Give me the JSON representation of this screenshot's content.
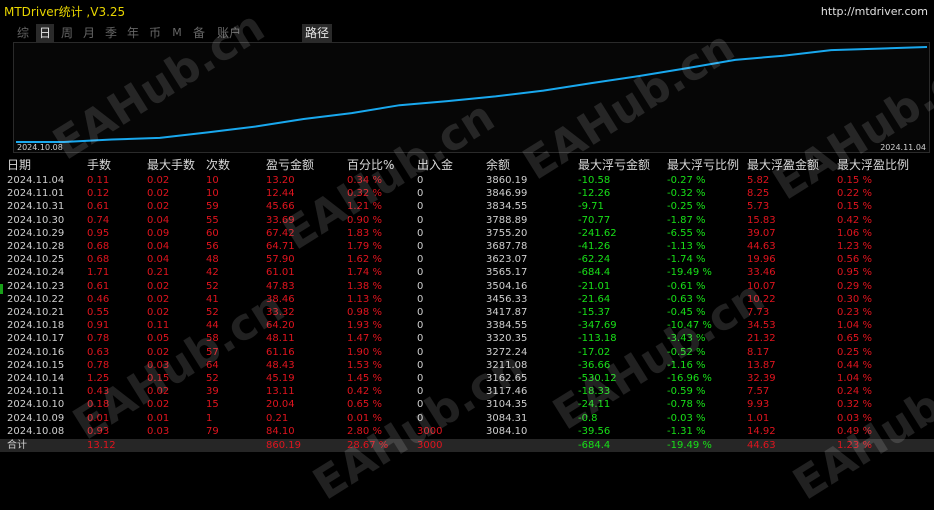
{
  "app": {
    "title": "MTDriver统计 ,V3.25",
    "url": "http://mtdriver.com"
  },
  "tabs": [
    {
      "label": "综",
      "active": false
    },
    {
      "label": "日",
      "active": true
    },
    {
      "label": "周",
      "active": false
    },
    {
      "label": "月",
      "active": false
    },
    {
      "label": "季",
      "active": false
    },
    {
      "label": "年",
      "active": false
    },
    {
      "label": "币",
      "active": false
    },
    {
      "label": "M",
      "active": false
    },
    {
      "label": "备",
      "active": false
    },
    {
      "label": "账户",
      "active": false
    },
    {
      "label": "路径",
      "active": true
    }
  ],
  "chart_data": {
    "type": "line",
    "x_start_label": "2024.10.08",
    "x_end_label": "2024.11.04",
    "x": [
      "2024.10.08",
      "2024.10.09",
      "2024.10.10",
      "2024.10.11",
      "2024.10.14",
      "2024.10.15",
      "2024.10.16",
      "2024.10.17",
      "2024.10.18",
      "2024.10.21",
      "2024.10.22",
      "2024.10.23",
      "2024.10.24",
      "2024.10.25",
      "2024.10.28",
      "2024.10.29",
      "2024.10.30",
      "2024.10.31",
      "2024.11.01",
      "2024.11.04"
    ],
    "y": [
      3084.1,
      3084.31,
      3104.35,
      3117.46,
      3162.65,
      3211.08,
      3272.24,
      3320.35,
      3384.55,
      3417.87,
      3456.33,
      3504.16,
      3565.17,
      3623.07,
      3687.78,
      3755.2,
      3788.89,
      3834.55,
      3846.99,
      3860.19
    ],
    "series_color": "#19a8ee",
    "grid": false
  },
  "table": {
    "headers": [
      "日期",
      "手数",
      "最大手数",
      "次数",
      "盈亏金额",
      "百分比%",
      "出入金",
      "余额",
      "最大浮亏金额",
      "最大浮亏比例",
      "最大浮盈金额",
      "最大浮盈比例"
    ],
    "rows": [
      [
        "2024.11.04",
        "0.11",
        "0.02",
        "10",
        "13.20",
        "0.34 %",
        "0",
        "3860.19",
        "-10.58",
        "-0.27 %",
        "5.82",
        "0.15 %"
      ],
      [
        "2024.11.01",
        "0.12",
        "0.02",
        "10",
        "12.44",
        "0.32 %",
        "0",
        "3846.99",
        "-12.26",
        "-0.32 %",
        "8.25",
        "0.22 %"
      ],
      [
        "2024.10.31",
        "0.61",
        "0.02",
        "59",
        "45.66",
        "1.21 %",
        "0",
        "3834.55",
        "-9.71",
        "-0.25 %",
        "5.73",
        "0.15 %"
      ],
      [
        "2024.10.30",
        "0.74",
        "0.04",
        "55",
        "33.69",
        "0.90 %",
        "0",
        "3788.89",
        "-70.77",
        "-1.87 %",
        "15.83",
        "0.42 %"
      ],
      [
        "2024.10.29",
        "0.95",
        "0.09",
        "60",
        "67.42",
        "1.83 %",
        "0",
        "3755.20",
        "-241.62",
        "-6.55 %",
        "39.07",
        "1.06 %"
      ],
      [
        "2024.10.28",
        "0.68",
        "0.04",
        "56",
        "64.71",
        "1.79 %",
        "0",
        "3687.78",
        "-41.26",
        "-1.13 %",
        "44.63",
        "1.23 %"
      ],
      [
        "2024.10.25",
        "0.68",
        "0.04",
        "48",
        "57.90",
        "1.62 %",
        "0",
        "3623.07",
        "-62.24",
        "-1.74 %",
        "19.96",
        "0.56 %"
      ],
      [
        "2024.10.24",
        "1.71",
        "0.21",
        "42",
        "61.01",
        "1.74 %",
        "0",
        "3565.17",
        "-684.4",
        "-19.49 %",
        "33.46",
        "0.95 %"
      ],
      [
        "2024.10.23",
        "0.61",
        "0.02",
        "52",
        "47.83",
        "1.38 %",
        "0",
        "3504.16",
        "-21.01",
        "-0.61 %",
        "10.07",
        "0.29 %"
      ],
      [
        "2024.10.22",
        "0.46",
        "0.02",
        "41",
        "38.46",
        "1.13 %",
        "0",
        "3456.33",
        "-21.64",
        "-0.63 %",
        "10.22",
        "0.30 %"
      ],
      [
        "2024.10.21",
        "0.55",
        "0.02",
        "52",
        "33.32",
        "0.98 %",
        "0",
        "3417.87",
        "-15.37",
        "-0.45 %",
        "7.73",
        "0.23 %"
      ],
      [
        "2024.10.18",
        "0.91",
        "0.11",
        "44",
        "64.20",
        "1.93 %",
        "0",
        "3384.55",
        "-347.69",
        "-10.47 %",
        "34.53",
        "1.04 %"
      ],
      [
        "2024.10.17",
        "0.78",
        "0.05",
        "58",
        "48.11",
        "1.47 %",
        "0",
        "3320.35",
        "-113.18",
        "-3.43 %",
        "21.32",
        "0.65 %"
      ],
      [
        "2024.10.16",
        "0.63",
        "0.02",
        "57",
        "61.16",
        "1.90 %",
        "0",
        "3272.24",
        "-17.02",
        "-0.52 %",
        "8.17",
        "0.25 %"
      ],
      [
        "2024.10.15",
        "0.78",
        "0.03",
        "64",
        "48.43",
        "1.53 %",
        "0",
        "3211.08",
        "-36.66",
        "-1.16 %",
        "13.87",
        "0.44 %"
      ],
      [
        "2024.10.14",
        "1.25",
        "0.15",
        "52",
        "45.19",
        "1.45 %",
        "0",
        "3162.65",
        "-530.12",
        "-16.96 %",
        "32.39",
        "1.04 %"
      ],
      [
        "2024.10.11",
        "0.43",
        "0.02",
        "39",
        "13.11",
        "0.42 %",
        "0",
        "3117.46",
        "-18.33",
        "-0.59 %",
        "7.57",
        "0.24 %"
      ],
      [
        "2024.10.10",
        "0.18",
        "0.02",
        "15",
        "20.04",
        "0.65 %",
        "0",
        "3104.35",
        "-24.11",
        "-0.78 %",
        "9.93",
        "0.32 %"
      ],
      [
        "2024.10.09",
        "0.01",
        "0.01",
        "1",
        "0.21",
        "0.01 %",
        "0",
        "3084.31",
        "-0.8",
        "-0.03 %",
        "1.01",
        "0.03 %"
      ],
      [
        "2024.10.08",
        "0.93",
        "0.03",
        "79",
        "84.10",
        "2.80 %",
        "3000",
        "3084.10",
        "-39.56",
        "-1.31 %",
        "14.92",
        "0.49 %"
      ]
    ],
    "total": [
      "合计",
      "13.12",
      "",
      "",
      "860.19",
      "28.67 %",
      "3000",
      "",
      "-684.4",
      "-19.49 %",
      "44.63",
      "1.23 %"
    ]
  },
  "watermark": "EAHub.cn",
  "colors": {
    "positive": "#e0141e",
    "negative": "#18e018",
    "line": "#19a8ee",
    "title": "#e8d500"
  }
}
